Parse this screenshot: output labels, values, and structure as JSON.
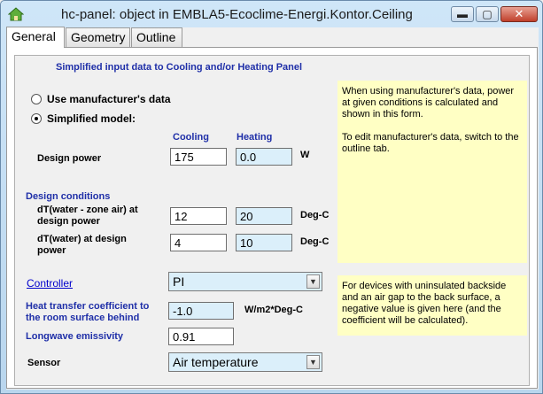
{
  "window": {
    "title": "hc-panel: object in EMBLA5-Ecoclime-Energi.Kontor.Ceiling",
    "minimize_glyph": "▬",
    "maximize_glyph": "▢",
    "close_glyph": "✕"
  },
  "tabs": [
    {
      "label": "General"
    },
    {
      "label": "Geometry"
    },
    {
      "label": "Outline"
    }
  ],
  "form": {
    "heading": "Simplified input data to Cooling and/or Heating Panel",
    "radio_manufacturer": "Use manufacturer's data",
    "radio_simplified": "Simplified model:",
    "col_cooling": "Cooling",
    "col_heating": "Heating",
    "design_power_label": "Design power",
    "design_power_cooling": "175",
    "design_power_heating": "0.0",
    "design_power_unit": "W",
    "design_conditions_label": "Design conditions",
    "dt_zone_label_1": "dT(water - zone air) at",
    "dt_zone_label_2": "design power",
    "dt_zone_cooling": "12",
    "dt_zone_heating": "20",
    "dt_zone_unit": "Deg-C",
    "dt_water_label_1": "dT(water) at design",
    "dt_water_label_2": "power",
    "dt_water_cooling": "4",
    "dt_water_heating": "10",
    "dt_water_unit": "Deg-C",
    "controller_label": "Controller",
    "controller_value": "PI",
    "htc_label_1": "Heat transfer coefficient to",
    "htc_label_2": "the room surface behind",
    "htc_value": "-1.0",
    "htc_unit": "W/m2*Deg-C",
    "emissivity_label": "Longwave emissivity",
    "emissivity_value": "0.91",
    "sensor_label": "Sensor",
    "sensor_value": "Air temperature"
  },
  "notes": {
    "manufacturer_note_1": "When using manufacturer's data, power at given conditions is calculated and shown in this form.",
    "manufacturer_note_2": "To edit manufacturer's data, switch to the outline tab.",
    "backside_note": "For devices with uninsulated backside and an air gap to the back surface, a negative value is given here (and the coefficient will be calculated)."
  },
  "colors": {
    "label_blue": "#1f2fa8",
    "readonly_field": "#dbeffa",
    "note_background": "#ffffc4"
  }
}
